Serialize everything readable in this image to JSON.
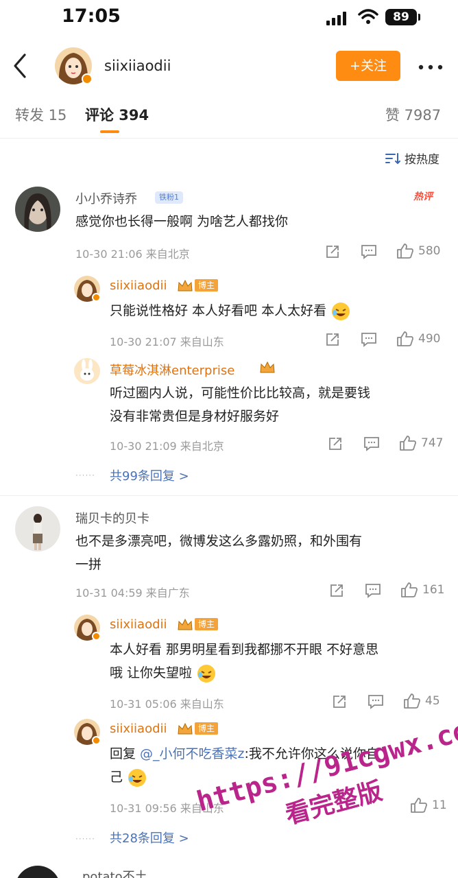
{
  "status_bar": {
    "time": "17:05",
    "battery": "89"
  },
  "header": {
    "username": "siixiiaodii",
    "follow_label": "+关注"
  },
  "tabs": {
    "repost": "转发 15",
    "comments": "评论 394",
    "likes": "赞 7987"
  },
  "sort_label": "按热度",
  "comments": [
    {
      "name": "小小乔诗乔",
      "fan_badge": "铁粉1",
      "hot_label": "热评",
      "text_lines": [
        "感觉你也长得一般啊 为啥艺人都找你"
      ],
      "meta": "10-30 21:06 来自北京",
      "likes": "580",
      "replies": [
        {
          "name": "siixiiaodii",
          "role_badge": "博主",
          "text_lines": [
            "只能说性格好 本人好看吧 本人太好看"
          ],
          "meta": "10-30 21:07 来自山东",
          "likes": "490"
        },
        {
          "name": "草莓冰淇淋enterprise",
          "text_lines": [
            "听过圈内人说，可能性价比比较高，就是要钱",
            "没有非常贵但是身材好服务好"
          ],
          "meta": "10-30 21:09 来自北京",
          "likes": "747"
        }
      ],
      "more_replies": "共99条回复 >"
    },
    {
      "name": "瑞贝卡的贝卡",
      "text_lines": [
        "也不是多漂亮吧，微博发这么多露奶照，和外围有",
        "一拼"
      ],
      "meta": "10-31 04:59 来自广东",
      "likes": "161",
      "replies": [
        {
          "name": "siixiiaodii",
          "role_badge": "博主",
          "text_lines": [
            "本人好看 那男明星看到我都挪不开眼 不好意思",
            "哦 让你失望啦"
          ],
          "meta": "10-31 05:06 来自山东",
          "likes": "45"
        },
        {
          "name": "siixiiaodii",
          "role_badge": "博主",
          "reply_prefix": "回复 ",
          "mention": "@_小何不吃香菜z",
          "text_lines": [
            ":我不允许你这么说你自",
            "己"
          ],
          "meta": "10-31 09:56 来自山东",
          "likes": "11"
        }
      ],
      "more_replies": "共28条回复 >"
    },
    {
      "name": "potato不土"
    }
  ],
  "watermark": {
    "url": "https://91cgwx.com",
    "sub": "看完整版"
  }
}
